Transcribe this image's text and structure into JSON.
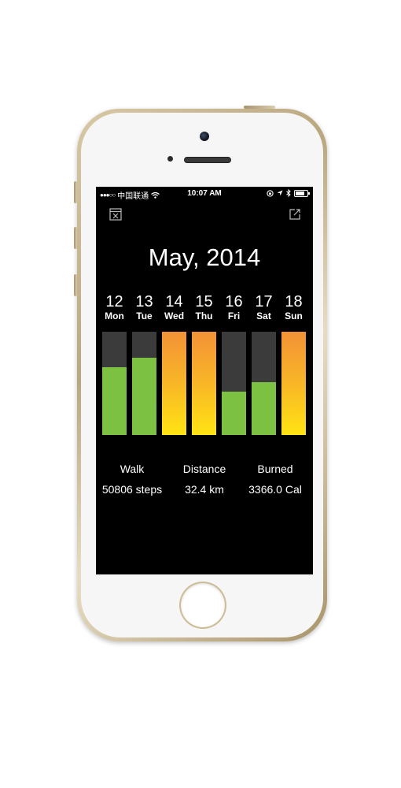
{
  "status_bar": {
    "signal_dots": "●●●○○",
    "carrier": "中国联通",
    "time": "10:07 AM"
  },
  "header": {
    "left_icon": "calendar-close-icon",
    "right_icon": "share-icon",
    "title": "May, 2014"
  },
  "days": [
    {
      "num": "12",
      "name": "Mon",
      "fill_fraction": 0.66,
      "goal_met": false
    },
    {
      "num": "13",
      "name": "Tue",
      "fill_fraction": 0.75,
      "goal_met": false
    },
    {
      "num": "14",
      "name": "Wed",
      "fill_fraction": 1.0,
      "goal_met": true
    },
    {
      "num": "15",
      "name": "Thu",
      "fill_fraction": 1.0,
      "goal_met": true
    },
    {
      "num": "16",
      "name": "Fri",
      "fill_fraction": 0.42,
      "goal_met": false
    },
    {
      "num": "17",
      "name": "Sat",
      "fill_fraction": 0.51,
      "goal_met": false
    },
    {
      "num": "18",
      "name": "Sun",
      "fill_fraction": 1.0,
      "goal_met": true
    }
  ],
  "stats": [
    {
      "label": "Walk",
      "value": "50806 steps"
    },
    {
      "label": "Distance",
      "value": "32.4 km"
    },
    {
      "label": "Burned",
      "value": "3366.0 Cal"
    }
  ],
  "colors": {
    "walk_bar": "#7cc142",
    "goal_bar_top": "#f39136",
    "goal_bar_bottom": "#ffe413",
    "bar_track": "#3b3b3b"
  }
}
